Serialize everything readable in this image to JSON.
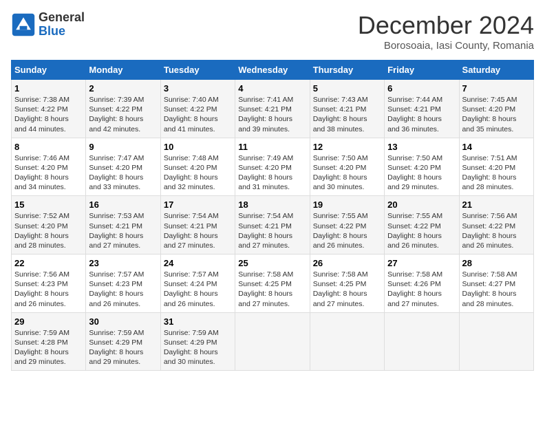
{
  "logo": {
    "line1": "General",
    "line2": "Blue"
  },
  "title": "December 2024",
  "subtitle": "Borosoaia, Iasi County, Romania",
  "headers": [
    "Sunday",
    "Monday",
    "Tuesday",
    "Wednesday",
    "Thursday",
    "Friday",
    "Saturday"
  ],
  "weeks": [
    [
      {
        "day": "1",
        "text": "Sunrise: 7:38 AM\nSunset: 4:22 PM\nDaylight: 8 hours\nand 44 minutes."
      },
      {
        "day": "2",
        "text": "Sunrise: 7:39 AM\nSunset: 4:22 PM\nDaylight: 8 hours\nand 42 minutes."
      },
      {
        "day": "3",
        "text": "Sunrise: 7:40 AM\nSunset: 4:22 PM\nDaylight: 8 hours\nand 41 minutes."
      },
      {
        "day": "4",
        "text": "Sunrise: 7:41 AM\nSunset: 4:21 PM\nDaylight: 8 hours\nand 39 minutes."
      },
      {
        "day": "5",
        "text": "Sunrise: 7:43 AM\nSunset: 4:21 PM\nDaylight: 8 hours\nand 38 minutes."
      },
      {
        "day": "6",
        "text": "Sunrise: 7:44 AM\nSunset: 4:21 PM\nDaylight: 8 hours\nand 36 minutes."
      },
      {
        "day": "7",
        "text": "Sunrise: 7:45 AM\nSunset: 4:20 PM\nDaylight: 8 hours\nand 35 minutes."
      }
    ],
    [
      {
        "day": "8",
        "text": "Sunrise: 7:46 AM\nSunset: 4:20 PM\nDaylight: 8 hours\nand 34 minutes."
      },
      {
        "day": "9",
        "text": "Sunrise: 7:47 AM\nSunset: 4:20 PM\nDaylight: 8 hours\nand 33 minutes."
      },
      {
        "day": "10",
        "text": "Sunrise: 7:48 AM\nSunset: 4:20 PM\nDaylight: 8 hours\nand 32 minutes."
      },
      {
        "day": "11",
        "text": "Sunrise: 7:49 AM\nSunset: 4:20 PM\nDaylight: 8 hours\nand 31 minutes."
      },
      {
        "day": "12",
        "text": "Sunrise: 7:50 AM\nSunset: 4:20 PM\nDaylight: 8 hours\nand 30 minutes."
      },
      {
        "day": "13",
        "text": "Sunrise: 7:50 AM\nSunset: 4:20 PM\nDaylight: 8 hours\nand 29 minutes."
      },
      {
        "day": "14",
        "text": "Sunrise: 7:51 AM\nSunset: 4:20 PM\nDaylight: 8 hours\nand 28 minutes."
      }
    ],
    [
      {
        "day": "15",
        "text": "Sunrise: 7:52 AM\nSunset: 4:20 PM\nDaylight: 8 hours\nand 28 minutes."
      },
      {
        "day": "16",
        "text": "Sunrise: 7:53 AM\nSunset: 4:21 PM\nDaylight: 8 hours\nand 27 minutes."
      },
      {
        "day": "17",
        "text": "Sunrise: 7:54 AM\nSunset: 4:21 PM\nDaylight: 8 hours\nand 27 minutes."
      },
      {
        "day": "18",
        "text": "Sunrise: 7:54 AM\nSunset: 4:21 PM\nDaylight: 8 hours\nand 27 minutes."
      },
      {
        "day": "19",
        "text": "Sunrise: 7:55 AM\nSunset: 4:22 PM\nDaylight: 8 hours\nand 26 minutes."
      },
      {
        "day": "20",
        "text": "Sunrise: 7:55 AM\nSunset: 4:22 PM\nDaylight: 8 hours\nand 26 minutes."
      },
      {
        "day": "21",
        "text": "Sunrise: 7:56 AM\nSunset: 4:22 PM\nDaylight: 8 hours\nand 26 minutes."
      }
    ],
    [
      {
        "day": "22",
        "text": "Sunrise: 7:56 AM\nSunset: 4:23 PM\nDaylight: 8 hours\nand 26 minutes."
      },
      {
        "day": "23",
        "text": "Sunrise: 7:57 AM\nSunset: 4:23 PM\nDaylight: 8 hours\nand 26 minutes."
      },
      {
        "day": "24",
        "text": "Sunrise: 7:57 AM\nSunset: 4:24 PM\nDaylight: 8 hours\nand 26 minutes."
      },
      {
        "day": "25",
        "text": "Sunrise: 7:58 AM\nSunset: 4:25 PM\nDaylight: 8 hours\nand 27 minutes."
      },
      {
        "day": "26",
        "text": "Sunrise: 7:58 AM\nSunset: 4:25 PM\nDaylight: 8 hours\nand 27 minutes."
      },
      {
        "day": "27",
        "text": "Sunrise: 7:58 AM\nSunset: 4:26 PM\nDaylight: 8 hours\nand 27 minutes."
      },
      {
        "day": "28",
        "text": "Sunrise: 7:58 AM\nSunset: 4:27 PM\nDaylight: 8 hours\nand 28 minutes."
      }
    ],
    [
      {
        "day": "29",
        "text": "Sunrise: 7:59 AM\nSunset: 4:28 PM\nDaylight: 8 hours\nand 29 minutes."
      },
      {
        "day": "30",
        "text": "Sunrise: 7:59 AM\nSunset: 4:29 PM\nDaylight: 8 hours\nand 29 minutes."
      },
      {
        "day": "31",
        "text": "Sunrise: 7:59 AM\nSunset: 4:29 PM\nDaylight: 8 hours\nand 30 minutes."
      },
      null,
      null,
      null,
      null
    ]
  ]
}
